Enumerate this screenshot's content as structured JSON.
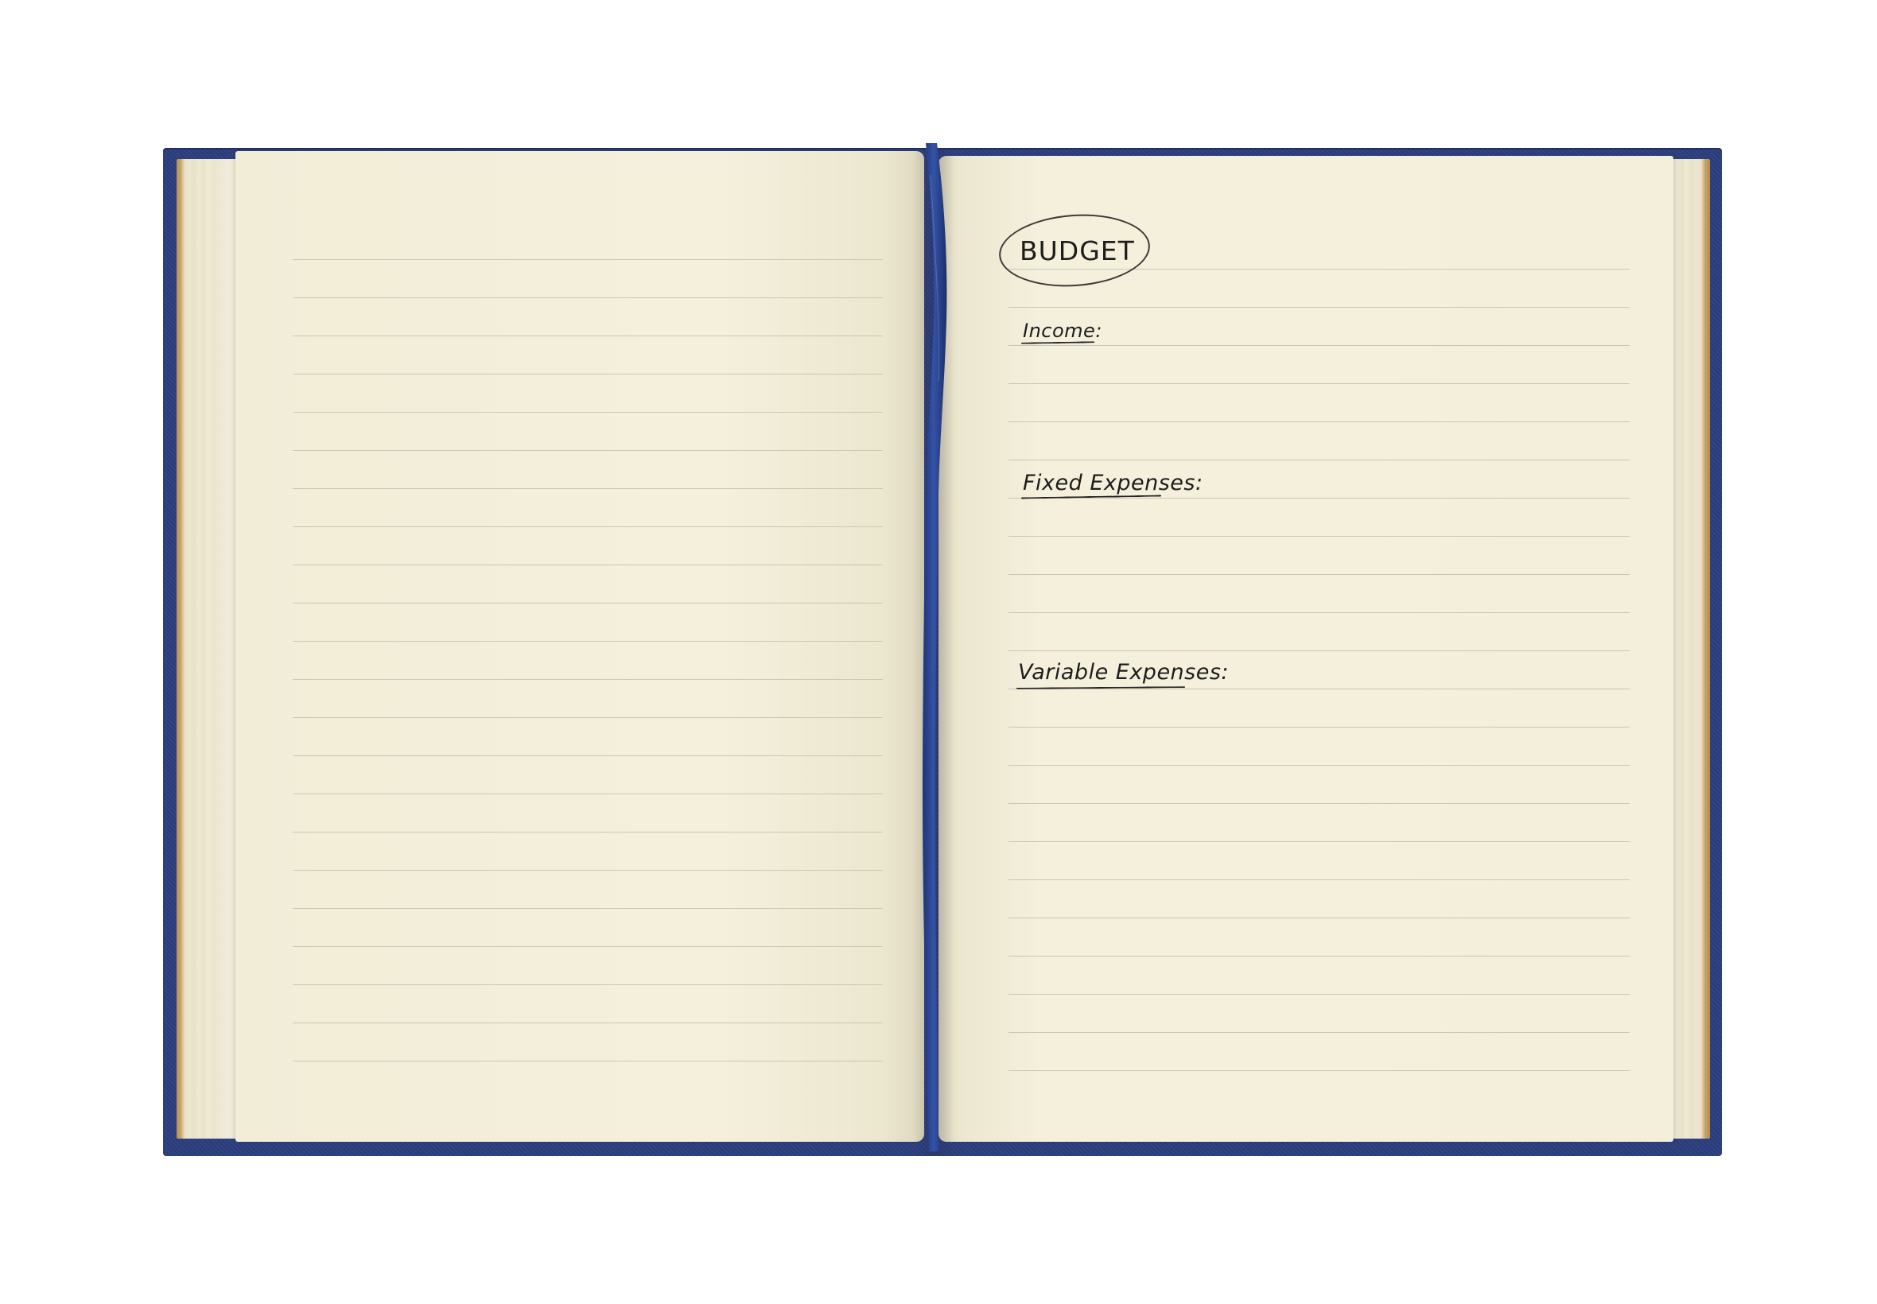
{
  "notebook": {
    "cover_color": "#2b3d7e",
    "page_color": "#f4f0db",
    "ribbon_color": "#2c4590",
    "left_page": {
      "ruled_lines": 22
    },
    "right_page": {
      "ruled_lines": 22,
      "title": "BUDGET",
      "sections": [
        {
          "label": "Income:"
        },
        {
          "label": "Fixed Expenses:"
        },
        {
          "label": "Variable Expenses:"
        }
      ]
    }
  }
}
